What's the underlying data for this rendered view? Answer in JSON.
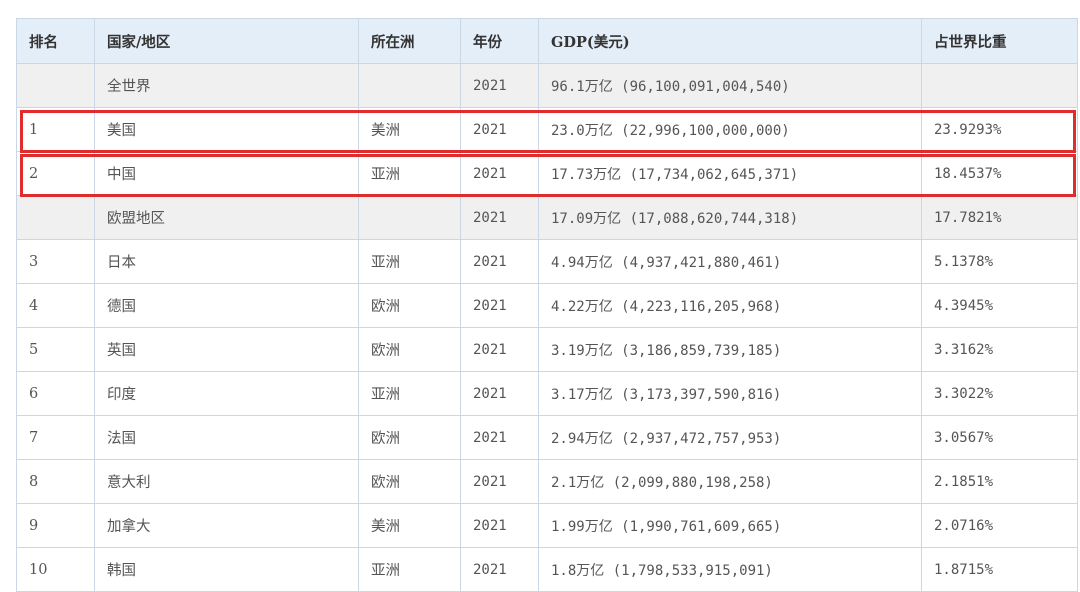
{
  "columns": [
    "排名",
    "国家/地区",
    "所在洲",
    "年份",
    "GDP(美元)",
    "占世界比重"
  ],
  "rows": [
    {
      "rank": "",
      "country": "全世界",
      "continent": "",
      "year": "2021",
      "gdp": "96.1万亿 (96,100,091,004,540)",
      "share": "",
      "aggregate": true,
      "highlight": false
    },
    {
      "rank": "1",
      "country": "美国",
      "continent": "美洲",
      "year": "2021",
      "gdp": "23.0万亿 (22,996,100,000,000)",
      "share": "23.9293%",
      "aggregate": false,
      "highlight": true
    },
    {
      "rank": "2",
      "country": "中国",
      "continent": "亚洲",
      "year": "2021",
      "gdp": "17.73万亿 (17,734,062,645,371)",
      "share": "18.4537%",
      "aggregate": false,
      "highlight": true
    },
    {
      "rank": "",
      "country": "欧盟地区",
      "continent": "",
      "year": "2021",
      "gdp": "17.09万亿 (17,088,620,744,318)",
      "share": "17.7821%",
      "aggregate": true,
      "highlight": false
    },
    {
      "rank": "3",
      "country": "日本",
      "continent": "亚洲",
      "year": "2021",
      "gdp": "4.94万亿 (4,937,421,880,461)",
      "share": "5.1378%",
      "aggregate": false,
      "highlight": false
    },
    {
      "rank": "4",
      "country": "德国",
      "continent": "欧洲",
      "year": "2021",
      "gdp": "4.22万亿 (4,223,116,205,968)",
      "share": "4.3945%",
      "aggregate": false,
      "highlight": false
    },
    {
      "rank": "5",
      "country": "英国",
      "continent": "欧洲",
      "year": "2021",
      "gdp": "3.19万亿 (3,186,859,739,185)",
      "share": "3.3162%",
      "aggregate": false,
      "highlight": false
    },
    {
      "rank": "6",
      "country": "印度",
      "continent": "亚洲",
      "year": "2021",
      "gdp": "3.17万亿 (3,173,397,590,816)",
      "share": "3.3022%",
      "aggregate": false,
      "highlight": false
    },
    {
      "rank": "7",
      "country": "法国",
      "continent": "欧洲",
      "year": "2021",
      "gdp": "2.94万亿 (2,937,472,757,953)",
      "share": "3.0567%",
      "aggregate": false,
      "highlight": false
    },
    {
      "rank": "8",
      "country": "意大利",
      "continent": "欧洲",
      "year": "2021",
      "gdp": "2.1万亿 (2,099,880,198,258)",
      "share": "2.1851%",
      "aggregate": false,
      "highlight": false
    },
    {
      "rank": "9",
      "country": "加拿大",
      "continent": "美洲",
      "year": "2021",
      "gdp": "1.99万亿 (1,990,761,609,665)",
      "share": "2.0716%",
      "aggregate": false,
      "highlight": false
    },
    {
      "rank": "10",
      "country": "韩国",
      "continent": "亚洲",
      "year": "2021",
      "gdp": "1.8万亿 (1,798,533,915,091)",
      "share": "1.8715%",
      "aggregate": false,
      "highlight": false
    }
  ],
  "colors": {
    "header_bg": "#e4eef9",
    "aggregate_bg": "#f0f0f0",
    "border": "#c9d7e6",
    "highlight": "#e02c2c"
  }
}
